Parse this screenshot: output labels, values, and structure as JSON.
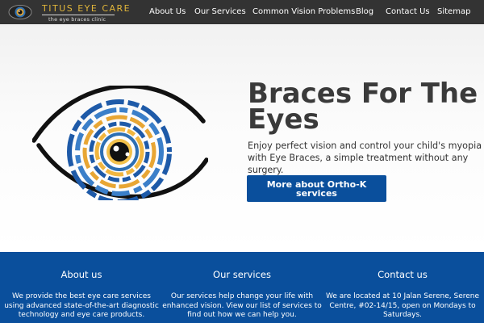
{
  "header": {
    "logo": {
      "title": "TITUS EYE CARE",
      "tagline": "the eye braces clinic",
      "icon": "eye-logo-icon"
    },
    "nav": [
      {
        "label": "About Us"
      },
      {
        "label": "Our Services"
      },
      {
        "label": "Common Vision Problems"
      },
      {
        "label": "Blog"
      },
      {
        "label": "Contact Us"
      },
      {
        "label": "Sitemap"
      }
    ]
  },
  "hero": {
    "illustration": "stylized-eye-icon",
    "title_line1": "Braces For The",
    "title_line2": "Eyes",
    "description": "Enjoy perfect vision and control your child's myopia with Eye Braces, a simple treatment without any surgery.",
    "button_label": "More about Ortho-K services"
  },
  "info": [
    {
      "title": "About us",
      "text": "We provide the best eye care services using advanced state-of-the-art diagnostic technology and eye care products."
    },
    {
      "title": "Our services",
      "text": "Our services help change your life with enhanced vision. View our list of services to find out how we can help you."
    },
    {
      "title": "Contact us",
      "text": "We are located at 10 Jalan Serene, Serene Centre, #02-14/15, open on Mondays to Saturdays."
    }
  ],
  "colors": {
    "header_bg": "#333333",
    "brand_gold": "#e0b53a",
    "accent_blue": "#0a4f9c",
    "hero_title": "#3a3a3a"
  }
}
